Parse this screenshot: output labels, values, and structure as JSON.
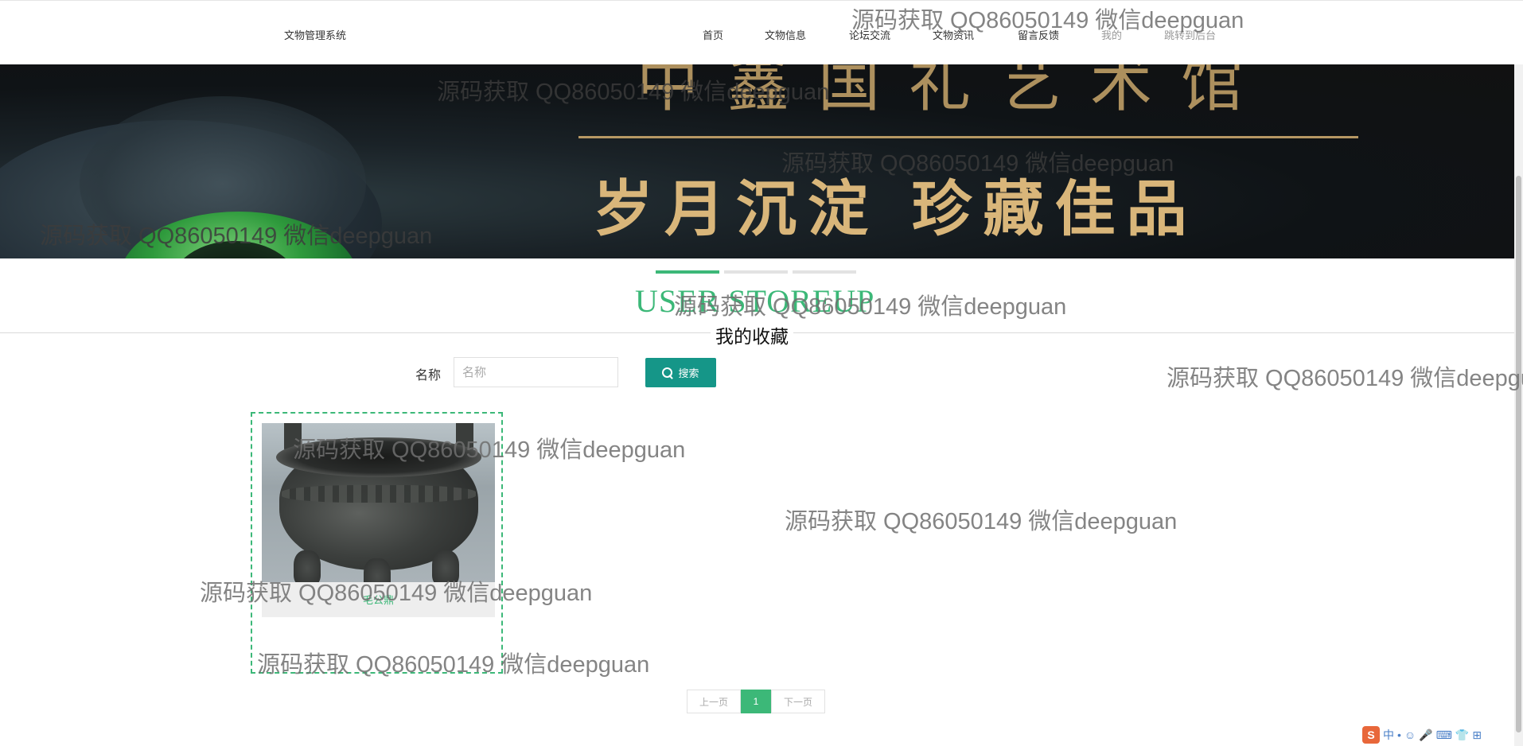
{
  "header": {
    "brand": "文物管理系统",
    "nav": [
      {
        "label": "首页"
      },
      {
        "label": "文物信息"
      },
      {
        "label": "论坛交流"
      },
      {
        "label": "文物资讯"
      },
      {
        "label": "留言反馈"
      },
      {
        "label": "我的"
      },
      {
        "label": "跳转到后台"
      }
    ]
  },
  "banner": {
    "slogan": "岁月沉淀 珍藏佳品",
    "title_partial": "中鑫国礼艺术馆"
  },
  "carousel": {
    "indicator_count": 3,
    "active_index": 0
  },
  "section": {
    "title_en": "USER STOREUP",
    "title_cn": "我的收藏"
  },
  "search": {
    "label": "名称",
    "placeholder": "名称",
    "value": "",
    "button_label": "搜索"
  },
  "favorites": [
    {
      "name": "毛公鼎"
    }
  ],
  "pagination": {
    "prev_label": "上一页",
    "current": "1",
    "next_label": "下一页"
  },
  "watermark": "源码获取 QQ86050149 微信deepguan",
  "colors": {
    "accent": "#3cb878",
    "search_button": "#159688"
  },
  "icons": {
    "search_button": "search-icon",
    "tray": "sogou-ime-icon"
  },
  "tray": {
    "logo": "S",
    "glyphs": [
      "中",
      "•",
      "☺",
      "🎤",
      "⌨",
      "👕",
      "⊞"
    ]
  }
}
